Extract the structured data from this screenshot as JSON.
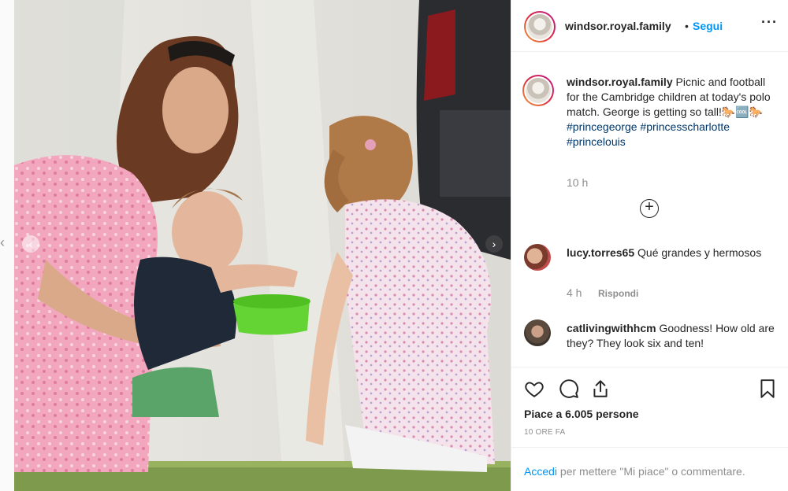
{
  "post": {
    "username": "windsor.royal.family",
    "separator": "•",
    "follow_label": "Segui",
    "more_icon": "more-horizontal-icon"
  },
  "caption": {
    "username": "windsor.royal.family",
    "text": " Picnic and football for the Cambridge children at today's polo match. George is getting so tall!🐎🆒🐎",
    "hashtags": [
      "#princegeorge",
      "#princesscharlotte",
      "#princelouis"
    ],
    "time": "10 h"
  },
  "load_more_icon": "plus-circle-icon",
  "comments": [
    {
      "username": "lucy.torres65",
      "text": " Qué grandes y hermosos",
      "time": "4 h",
      "reply_label": "Rispondi"
    },
    {
      "username": "catlivingwithhcm",
      "text": " Goodness! How old are they? They look six and ten!"
    }
  ],
  "actions": {
    "likes_text": "Piace a 6.005 persone",
    "timestamp": "10 ORE FA"
  },
  "login_prompt": {
    "link": "Accedi",
    "text": " per mettere \"Mi piace\" o commentare."
  },
  "colors": {
    "accent": "#0095f6",
    "hashtag": "#00376b",
    "muted": "#8e8e8e"
  }
}
